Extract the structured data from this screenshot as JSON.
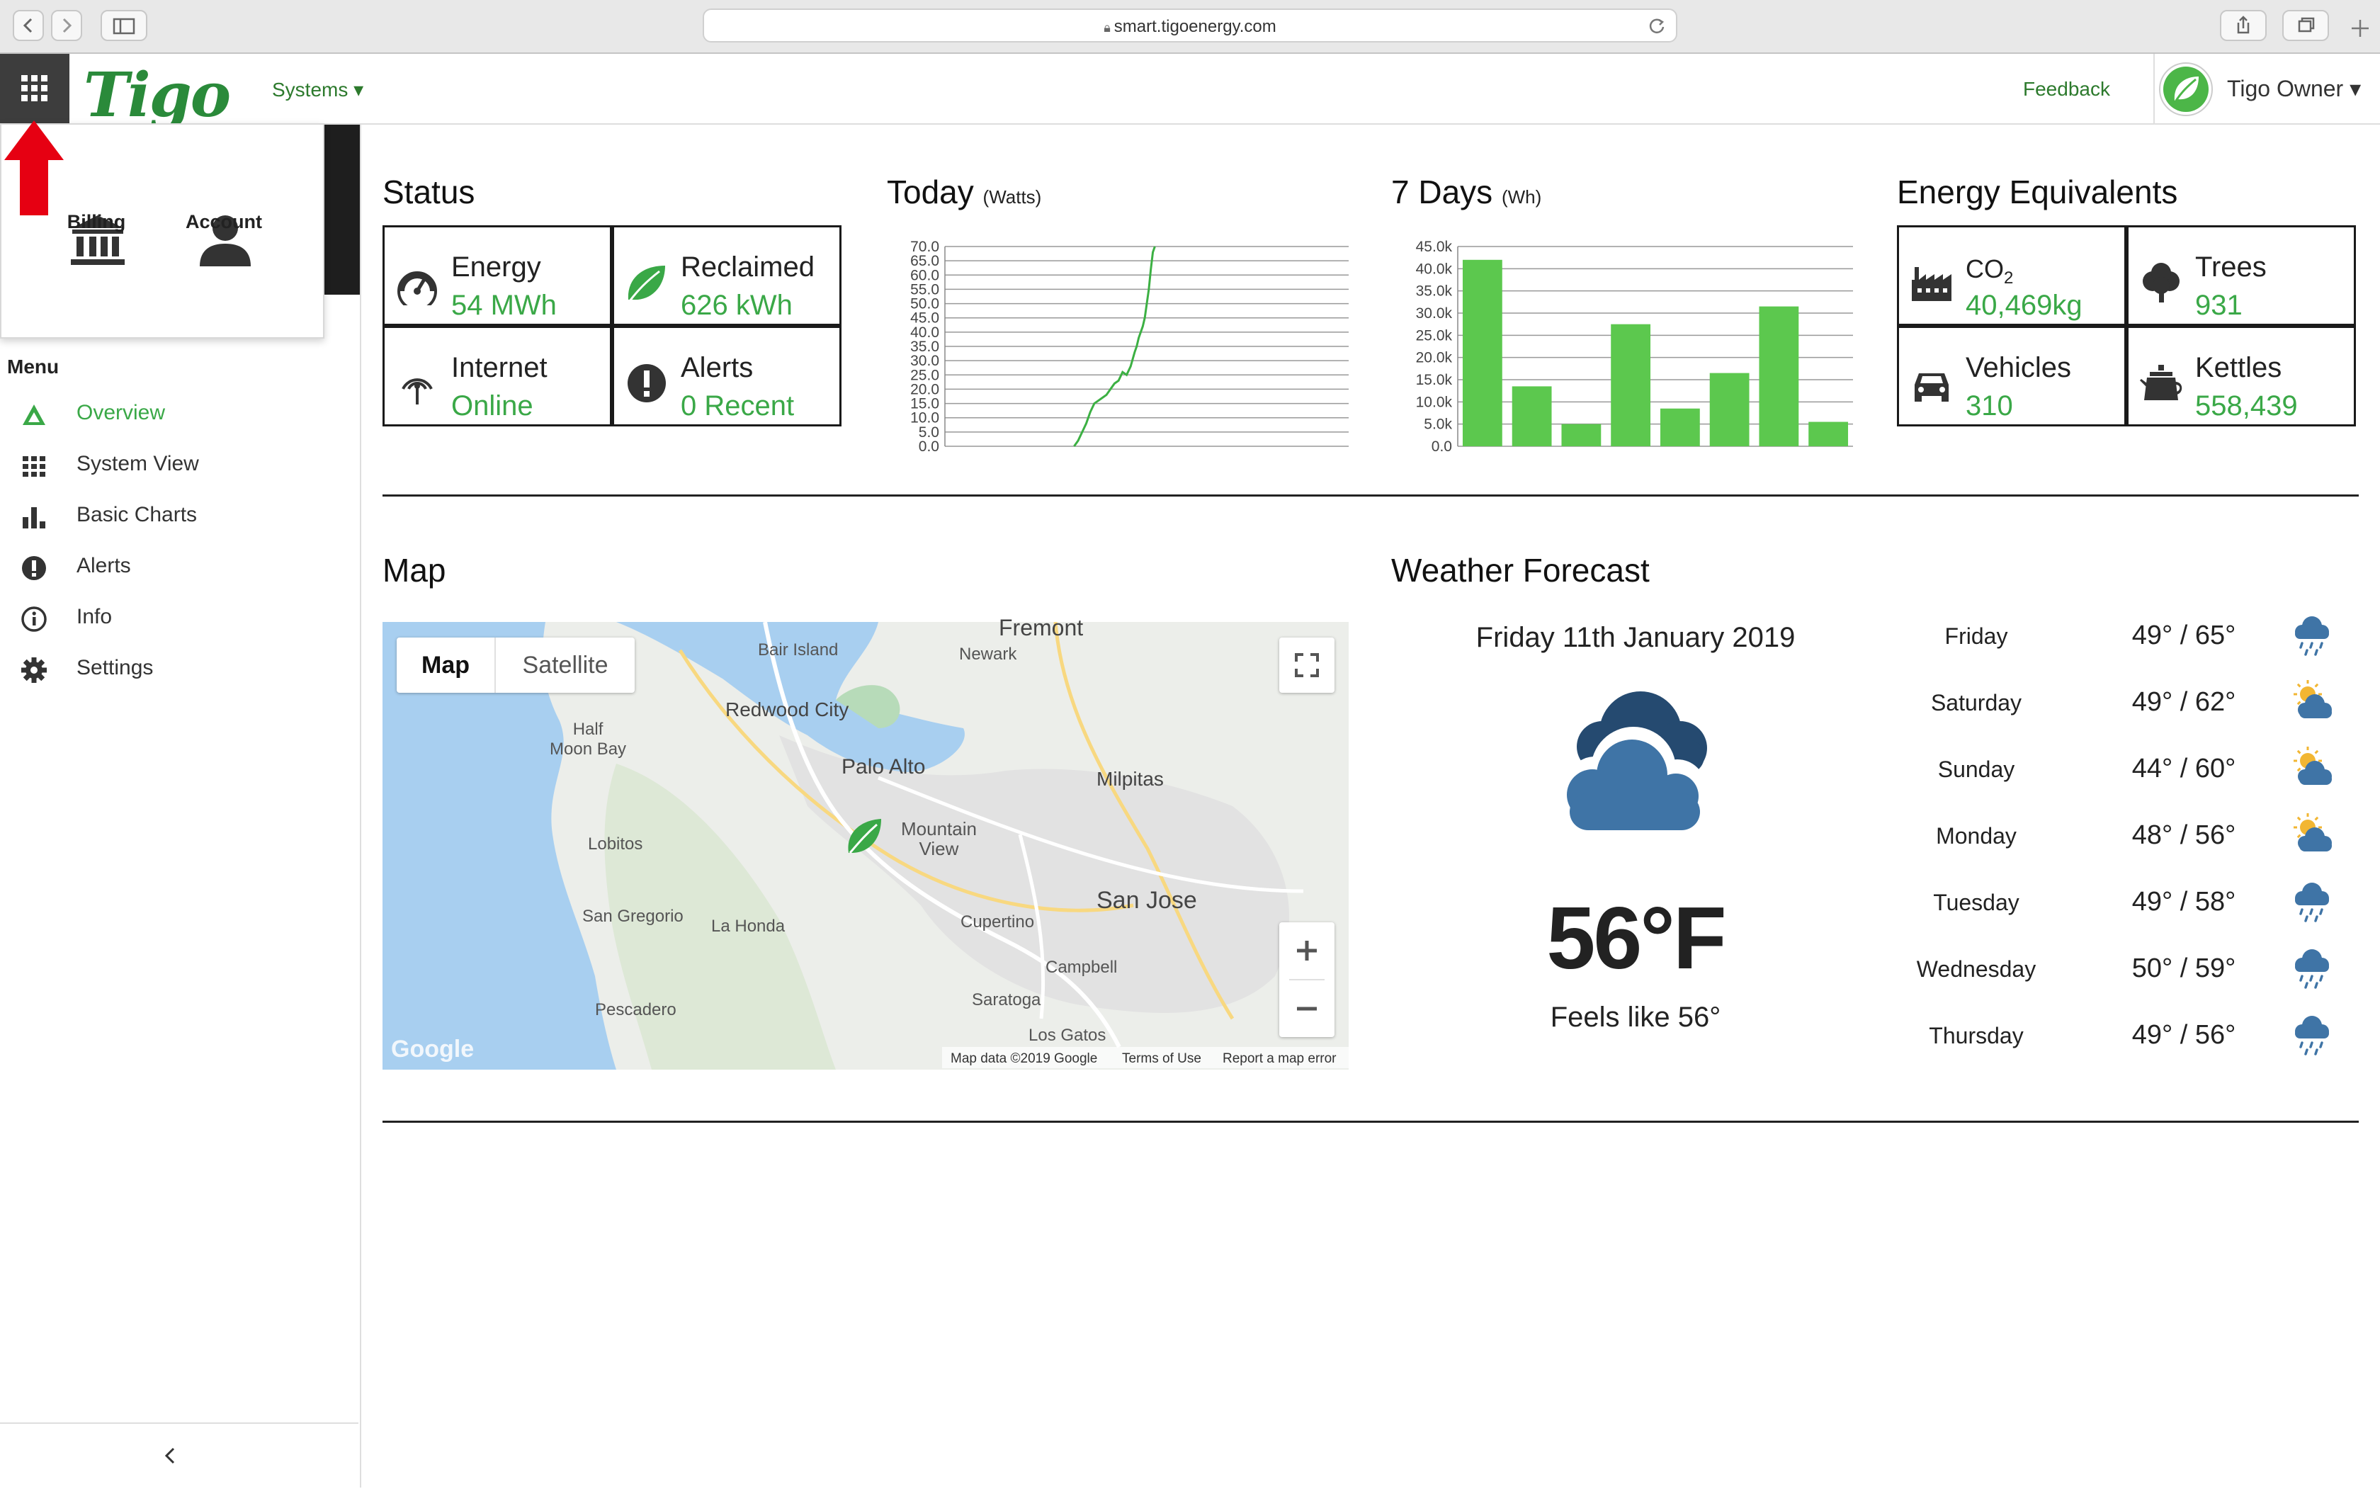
{
  "browser": {
    "url": "smart.tigoenergy.com"
  },
  "header": {
    "logo": "Tigo",
    "systems_label": "Systems ▾",
    "feedback_label": "Feedback",
    "user_name": "Tigo Owner ▾"
  },
  "popup": {
    "items": [
      {
        "label": "Billing",
        "icon": "bank-icon"
      },
      {
        "label": "Account",
        "icon": "person-icon"
      }
    ]
  },
  "sidebar": {
    "title": "Menu",
    "items": [
      {
        "label": "Overview",
        "icon": "triangle-icon",
        "active": true
      },
      {
        "label": "System View",
        "icon": "grid-icon"
      },
      {
        "label": "Basic Charts",
        "icon": "bar-chart-icon"
      },
      {
        "label": "Alerts",
        "icon": "exclamation-icon"
      },
      {
        "label": "Info",
        "icon": "info-icon"
      },
      {
        "label": "Settings",
        "icon": "gear-icon"
      }
    ],
    "collapse_label": "‹"
  },
  "status": {
    "title": "Status",
    "tiles": [
      {
        "label": "Energy",
        "value": "54 MWh",
        "icon": "gauge-icon"
      },
      {
        "label": "Reclaimed",
        "value": "626 kWh",
        "icon": "leaf-icon"
      },
      {
        "label": "Internet",
        "value": "Online",
        "icon": "antenna-icon"
      },
      {
        "label": "Alerts",
        "value": "0 Recent",
        "icon": "alert-icon"
      }
    ]
  },
  "today": {
    "title": "Today",
    "unit": "(Watts)"
  },
  "seven_days": {
    "title": "7 Days",
    "unit": "(Wh)"
  },
  "equivalents": {
    "title": "Energy Equivalents",
    "tiles": [
      {
        "label": "CO",
        "sub": "2",
        "value": "40,469kg",
        "icon": "factory-icon"
      },
      {
        "label": "Trees",
        "value": "931",
        "icon": "tree-icon"
      },
      {
        "label": "Vehicles",
        "value": "310",
        "icon": "car-icon"
      },
      {
        "label": "Kettles",
        "value": "558,439",
        "icon": "kettle-icon"
      }
    ]
  },
  "map": {
    "title": "Map",
    "tabs": [
      "Map",
      "Satellite"
    ],
    "active_tab": "Map",
    "attribution": {
      "data": "Map data ©2019 Google",
      "terms": "Terms of Use",
      "report": "Report a map error",
      "logo": "Google"
    },
    "places": [
      {
        "name": "Fremont"
      },
      {
        "name": "Bair Island"
      },
      {
        "name": "Newark"
      },
      {
        "name": "Redwood City"
      },
      {
        "name": "Half\nMoon Bay"
      },
      {
        "name": "Palo Alto"
      },
      {
        "name": "Milpitas"
      },
      {
        "name": "Mountain\nView"
      },
      {
        "name": "Lobitos"
      },
      {
        "name": "San Jose"
      },
      {
        "name": "San Gregorio"
      },
      {
        "name": "La Honda"
      },
      {
        "name": "Cupertino"
      },
      {
        "name": "Campbell"
      },
      {
        "name": "Saratoga"
      },
      {
        "name": "Pescadero"
      },
      {
        "name": "Los Gatos"
      }
    ]
  },
  "weather": {
    "title": "Weather Forecast",
    "date": "Friday 11th January 2019",
    "temperature": "56°F",
    "feels_like": "Feels like 56°",
    "current_icon": "cloudy-icon",
    "forecast": [
      {
        "day": "Friday",
        "temps": "49° / 65°",
        "icon": "rain-cloud-icon"
      },
      {
        "day": "Saturday",
        "temps": "49° / 62°",
        "icon": "sun-cloud-icon"
      },
      {
        "day": "Sunday",
        "temps": "44° / 60°",
        "icon": "sun-cloud-icon"
      },
      {
        "day": "Monday",
        "temps": "48° / 56°",
        "icon": "sun-cloud-icon"
      },
      {
        "day": "Tuesday",
        "temps": "49° / 58°",
        "icon": "rain-cloud-icon"
      },
      {
        "day": "Wednesday",
        "temps": "50° / 59°",
        "icon": "rain-cloud-icon"
      },
      {
        "day": "Thursday",
        "temps": "49° / 56°",
        "icon": "rain-cloud-icon"
      }
    ]
  },
  "colors": {
    "accent": "#3aa847",
    "bar": "#5cc84e",
    "line": "#3cb043",
    "weather_blue": "#3f74a6",
    "weather_dark": "#254a70"
  },
  "chart_data": [
    {
      "type": "line",
      "title": "Today",
      "ylabel": "(Watts)",
      "ylim": [
        0,
        70
      ],
      "yticks": [
        "0.0",
        "5.0",
        "10.0",
        "15.0",
        "20.0",
        "25.0",
        "30.0",
        "35.0",
        "40.0",
        "45.0",
        "50.0",
        "55.0",
        "60.0",
        "65.0",
        "70.0"
      ],
      "xlim": [
        0,
        100
      ],
      "series": [
        {
          "x": [
            32,
            33,
            34,
            35,
            36,
            37,
            38,
            39,
            40,
            41,
            42,
            43,
            44,
            45,
            46,
            47,
            47.5,
            48,
            49,
            49.5,
            50,
            50.5,
            51,
            51.5,
            52
          ],
          "y": [
            0,
            2,
            5,
            8,
            12,
            15,
            16,
            17,
            18,
            20,
            22,
            23,
            26,
            25,
            28,
            33,
            35,
            38,
            42,
            45,
            50,
            55,
            62,
            68,
            70
          ]
        }
      ]
    },
    {
      "type": "bar",
      "title": "7 Days",
      "ylabel": "(Wh)",
      "ylim": [
        0,
        45000
      ],
      "yticks": [
        "0.0",
        "5.0k",
        "10.0k",
        "15.0k",
        "20.0k",
        "25.0k",
        "30.0k",
        "35.0k",
        "40.0k",
        "45.0k"
      ],
      "values": [
        42000,
        13500,
        5000,
        27500,
        8500,
        16500,
        31500,
        5500
      ]
    }
  ]
}
